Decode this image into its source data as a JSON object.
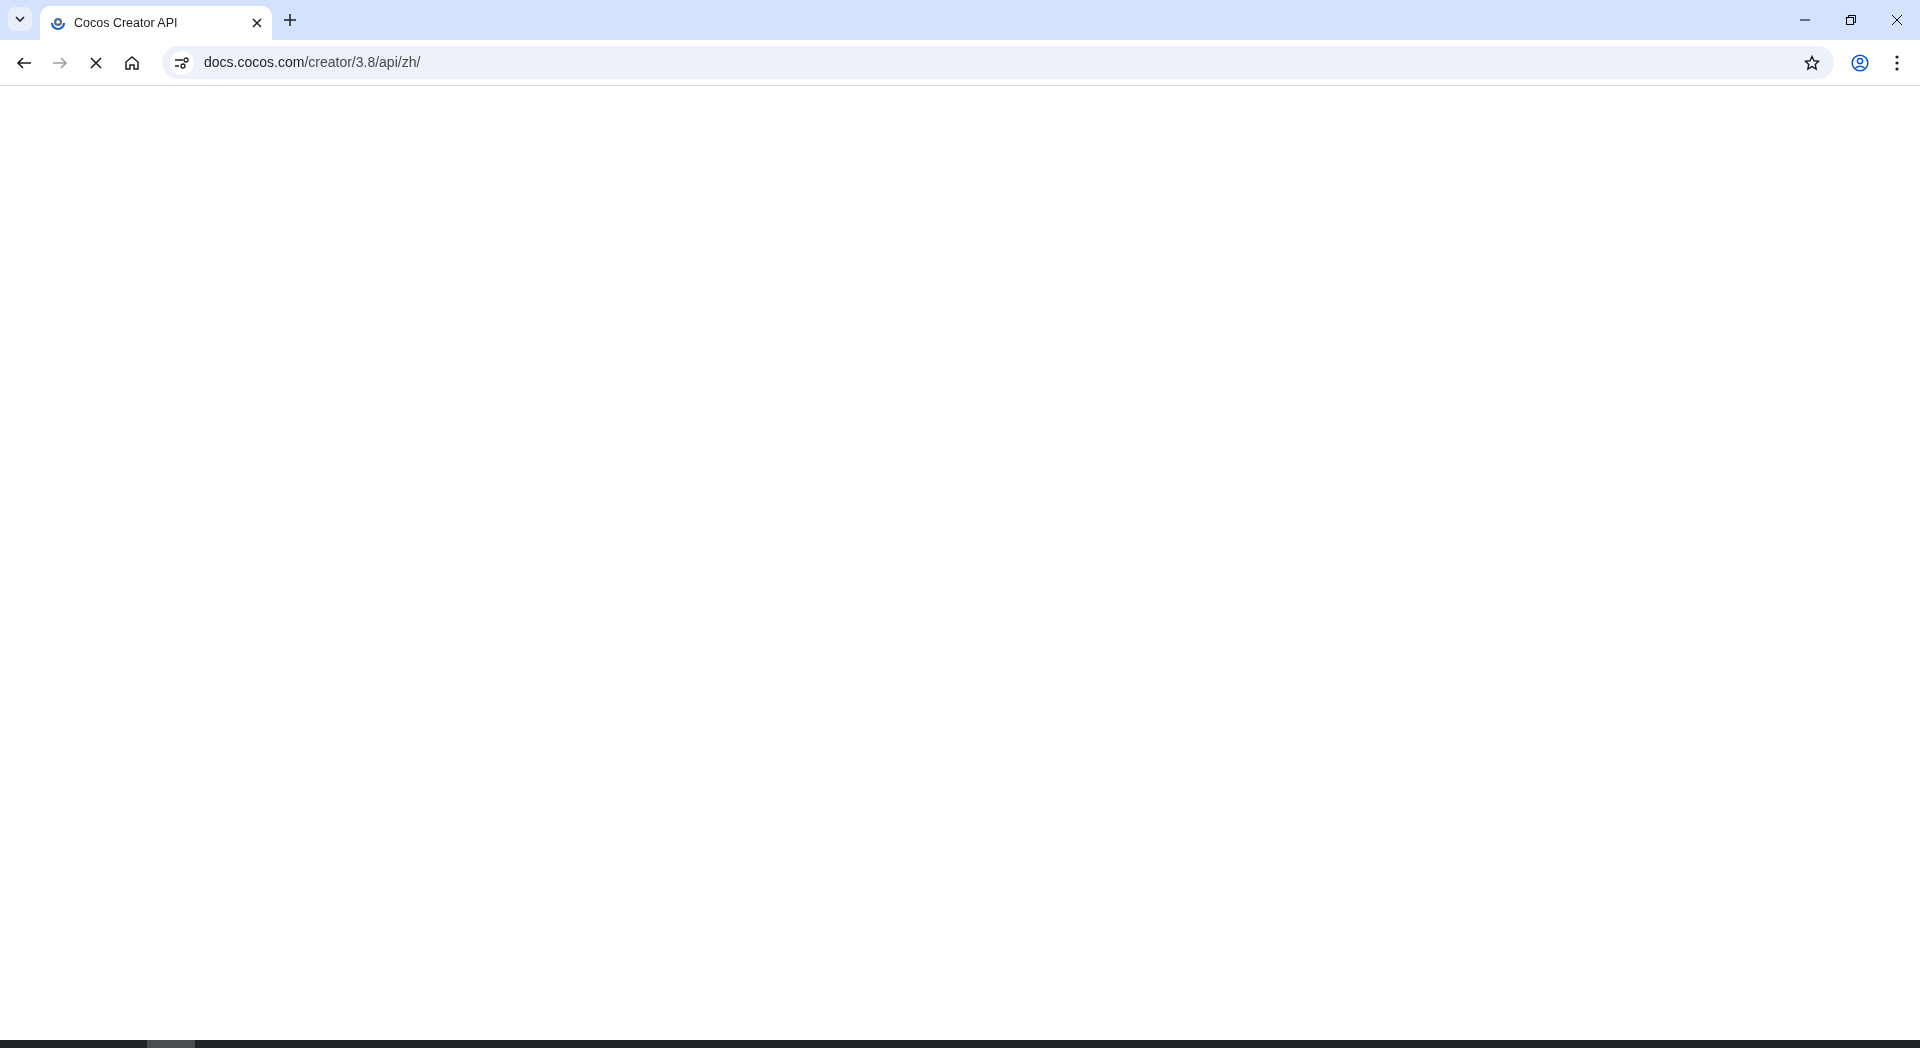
{
  "tabs": [
    {
      "title": "Cocos Creator API",
      "selected": true
    }
  ],
  "nav_buttons": [
    {
      "kind": "back",
      "disabled": false
    },
    {
      "kind": "forward",
      "disabled": true
    },
    {
      "kind": "stop",
      "disabled": false
    },
    {
      "kind": "home",
      "disabled": false
    }
  ],
  "address_bar": {
    "host": "docs.cocos.com",
    "path": "/creator/3.8/api/zh/"
  },
  "taskbar": {
    "items": [
      {
        "selected": true
      }
    ]
  }
}
